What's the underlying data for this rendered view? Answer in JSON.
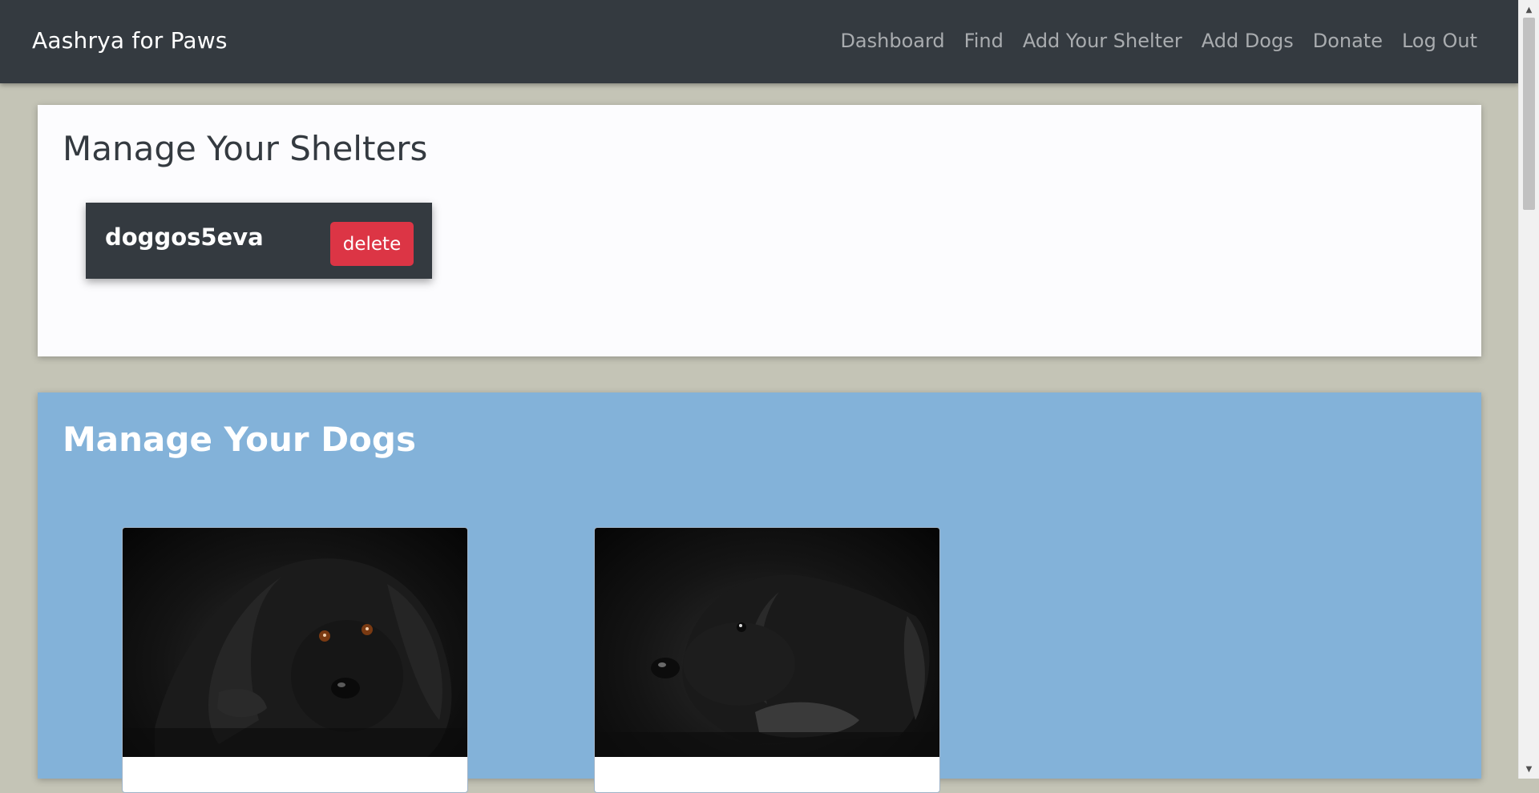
{
  "navbar": {
    "brand": "Aashrya for Paws",
    "links": [
      "Dashboard",
      "Find",
      "Add Your Shelter",
      "Add Dogs",
      "Donate",
      "Log Out"
    ]
  },
  "shelters": {
    "title": "Manage Your Shelters",
    "items": [
      {
        "name": "doggos5eva",
        "delete_label": "delete"
      }
    ]
  },
  "dogs": {
    "title": "Manage Your Dogs",
    "cards": [
      {
        "photo": "black spaniel dog lying down"
      },
      {
        "photo": "black labrador puppy lying down"
      }
    ]
  },
  "colors": {
    "navbar": "#343a40",
    "page_background": "#c4c4b6",
    "dogs_section": "#83b2d9",
    "delete_button": "#dc3545"
  }
}
